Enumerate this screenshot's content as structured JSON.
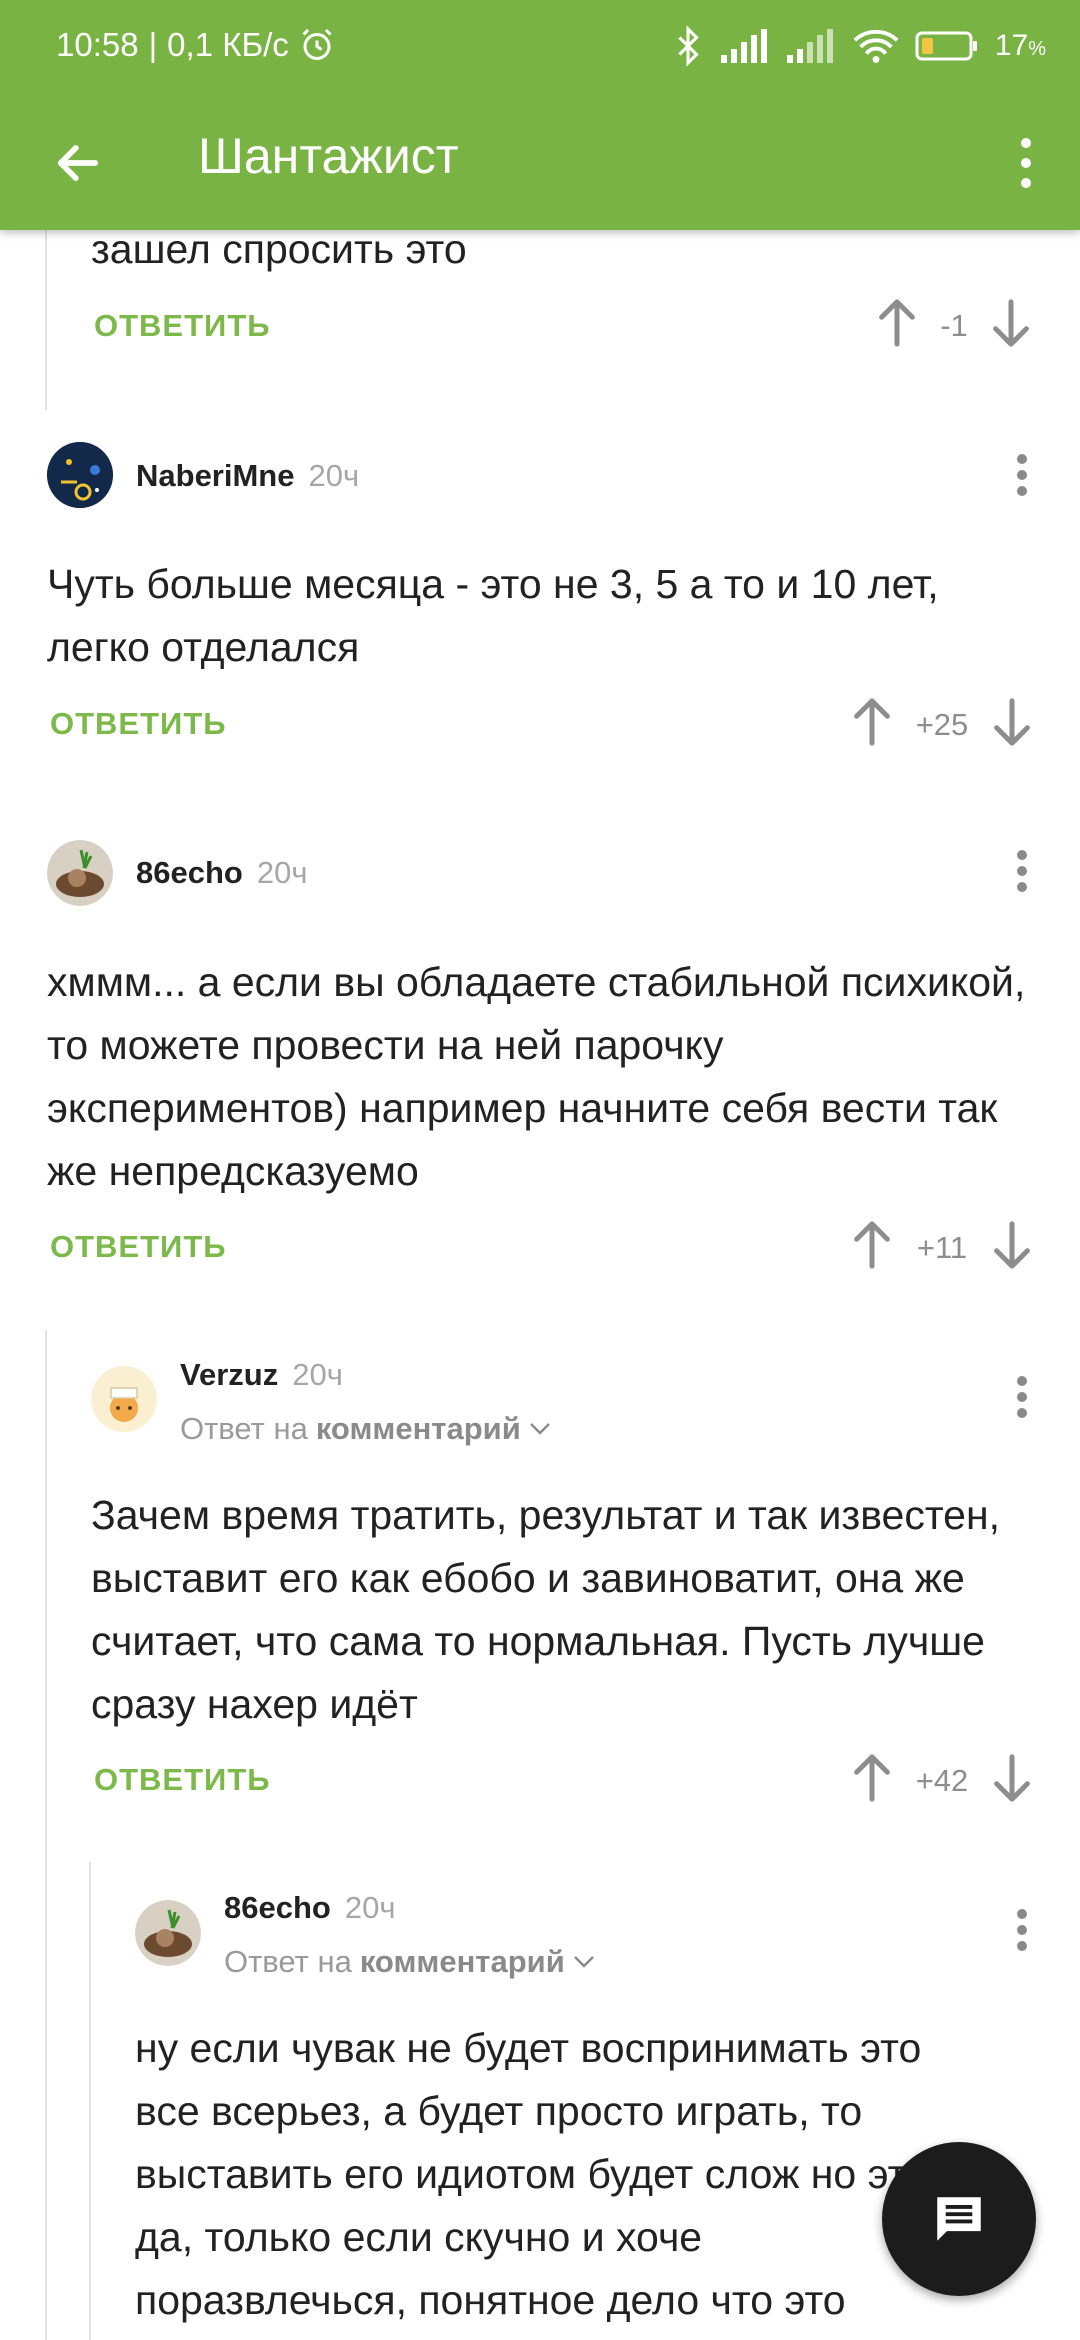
{
  "status_bar": {
    "time": "10:58",
    "speed": "0,1 КБ/с",
    "battery": "17",
    "battery_unit": "%",
    "icons": [
      "alarm-icon",
      "bluetooth-icon",
      "signal-icon",
      "signal-icon",
      "wifi-icon",
      "battery-icon"
    ]
  },
  "app_bar": {
    "title": "Шантажист",
    "back_icon": "arrow-left-icon",
    "menu_icon": "more-vertical-icon",
    "color": "#79b343"
  },
  "reply_label": "ОТВЕТИТЬ",
  "reply_to_prefix": "Ответ на",
  "reply_to_target": "комментарий",
  "comments": [
    {
      "text": "зашел спросить это",
      "score": "-1"
    },
    {
      "author": "NaberiMne",
      "time": "20ч",
      "text": "Чуть больше месяца - это не 3, 5 а то и 10 лет, легко отделался",
      "score": "+25"
    },
    {
      "author": "86echo",
      "time": "20ч",
      "text": "хммм... а если вы обладаете стабильной психикой, то можете провести на ней парочку экспериментов) например начните себя вести так же непредсказуемо",
      "score": "+11"
    },
    {
      "author": "Verzuz",
      "time": "20ч",
      "text": "Зачем время тратить, результат и так известен, выставит его как ебобо и завиноватит, она же считает, что сама то нормальная. Пусть лучше сразу нахер идёт",
      "score": "+42"
    },
    {
      "author": "86echo",
      "time": "20ч",
      "text": "ну если чувак не будет воспринимать это все всерьез, а будет просто играть, то выставить его идиотом будет слож но это да, только если скучно и хоче поразвлечься, понятное дело что это"
    }
  ],
  "fab_icon": "comment-icon",
  "accent_color": "#7cb94a"
}
